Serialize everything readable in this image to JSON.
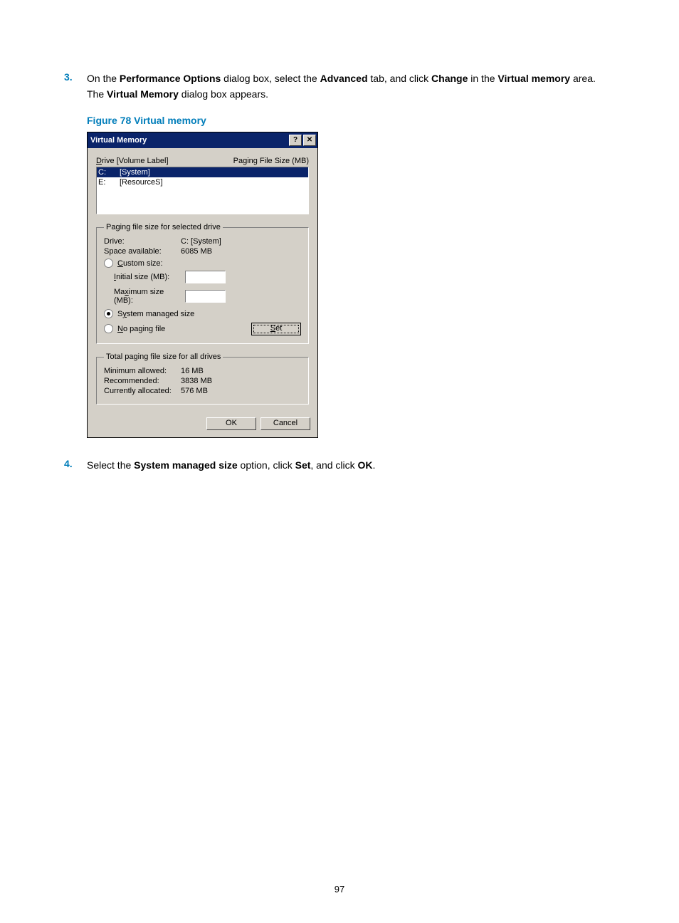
{
  "step3": {
    "num": "3.",
    "text_parts": {
      "a": "On the ",
      "b": "Performance Options",
      "c": " dialog box, select the ",
      "d": "Advanced",
      "e": " tab, and click ",
      "f": "Change",
      "g": " in the ",
      "h": "Virtual memory",
      "i": " area. The ",
      "j": "Virtual Memory",
      "k": " dialog box appears."
    }
  },
  "figure_caption": "Figure 78 Virtual memory",
  "dialog": {
    "title": "Virtual Memory",
    "help_btn": "?",
    "close_btn": "✕",
    "header": {
      "left_pre": "D",
      "left_post": "rive  [Volume Label]",
      "right": "Paging File Size (MB)"
    },
    "drives": {
      "row0": {
        "d": "C:",
        "l": "[System]"
      },
      "row1": {
        "d": "E:",
        "l": "[ResourceS]"
      }
    },
    "sel_group": {
      "legend": "Paging file size for selected drive",
      "drive_k": "Drive:",
      "drive_v": "C: [System]",
      "space_k": "Space available:",
      "space_v": "6085 MB",
      "custom_pre": "C",
      "custom_post": "ustom size:",
      "init_pre": "I",
      "init_post": "nitial size (MB):",
      "max_pre": "Ma",
      "max_u": "x",
      "max_post": "imum size (MB):",
      "sys_pre": "S",
      "sys_u": "y",
      "sys_post": "stem managed size",
      "none_pre": "N",
      "none_post": "o paging file",
      "set_pre": "S",
      "set_post": "et"
    },
    "total_group": {
      "legend": "Total paging file size for all drives",
      "min_k": "Minimum allowed:",
      "min_v": "16 MB",
      "rec_k": "Recommended:",
      "rec_v": "3838 MB",
      "cur_k": "Currently allocated:",
      "cur_v": "576 MB"
    },
    "ok": "OK",
    "cancel": "Cancel"
  },
  "step4": {
    "num": "4.",
    "a": "Select the ",
    "b": "System managed size",
    "c": " option, click ",
    "d": "Set",
    "e": ", and click ",
    "f": "OK",
    "g": "."
  },
  "page_number": "97"
}
